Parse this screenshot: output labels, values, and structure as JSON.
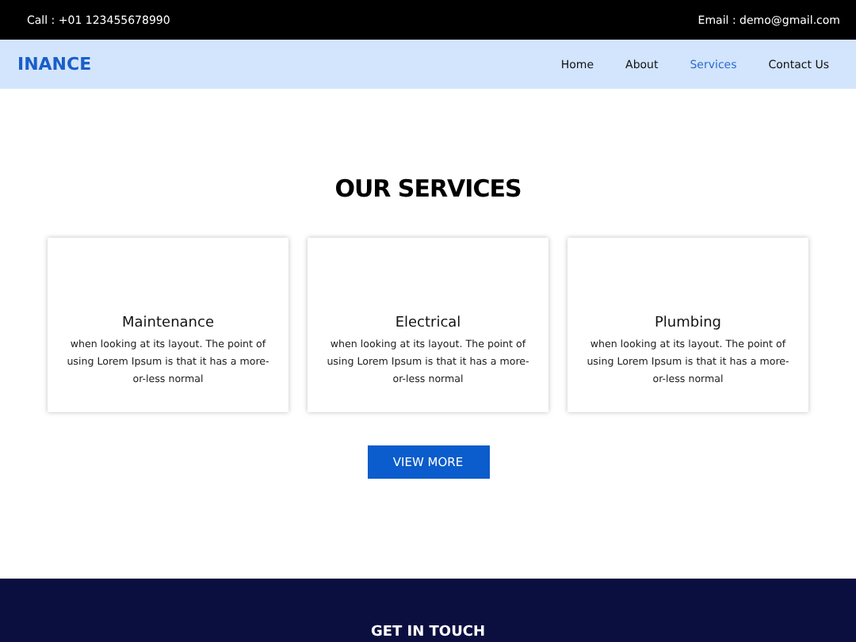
{
  "top_bar": {
    "call": "Call : +01 123455678990",
    "email": "Email : demo@gmail.com"
  },
  "navbar": {
    "logo": "INANCE",
    "links": [
      {
        "label": "Home",
        "selected": false
      },
      {
        "label": "About",
        "selected": false
      },
      {
        "label": "Services",
        "selected": true
      },
      {
        "label": "Contact Us",
        "selected": false
      }
    ]
  },
  "services": {
    "heading": "OUR SERVICES",
    "cards": [
      {
        "title": "Maintenance",
        "text": "when looking at its layout. The point of using Lorem Ipsum is that it has a more-or-less normal"
      },
      {
        "title": "Electrical",
        "text": "when looking at its layout. The point of using Lorem Ipsum is that it has a more-or-less normal"
      },
      {
        "title": "Plumbing",
        "text": "when looking at its layout. The point of using Lorem Ipsum is that it has a more-or-less normal"
      }
    ],
    "button": "VIEW MORE"
  },
  "contact": {
    "heading": "GET IN TOUCH"
  }
}
